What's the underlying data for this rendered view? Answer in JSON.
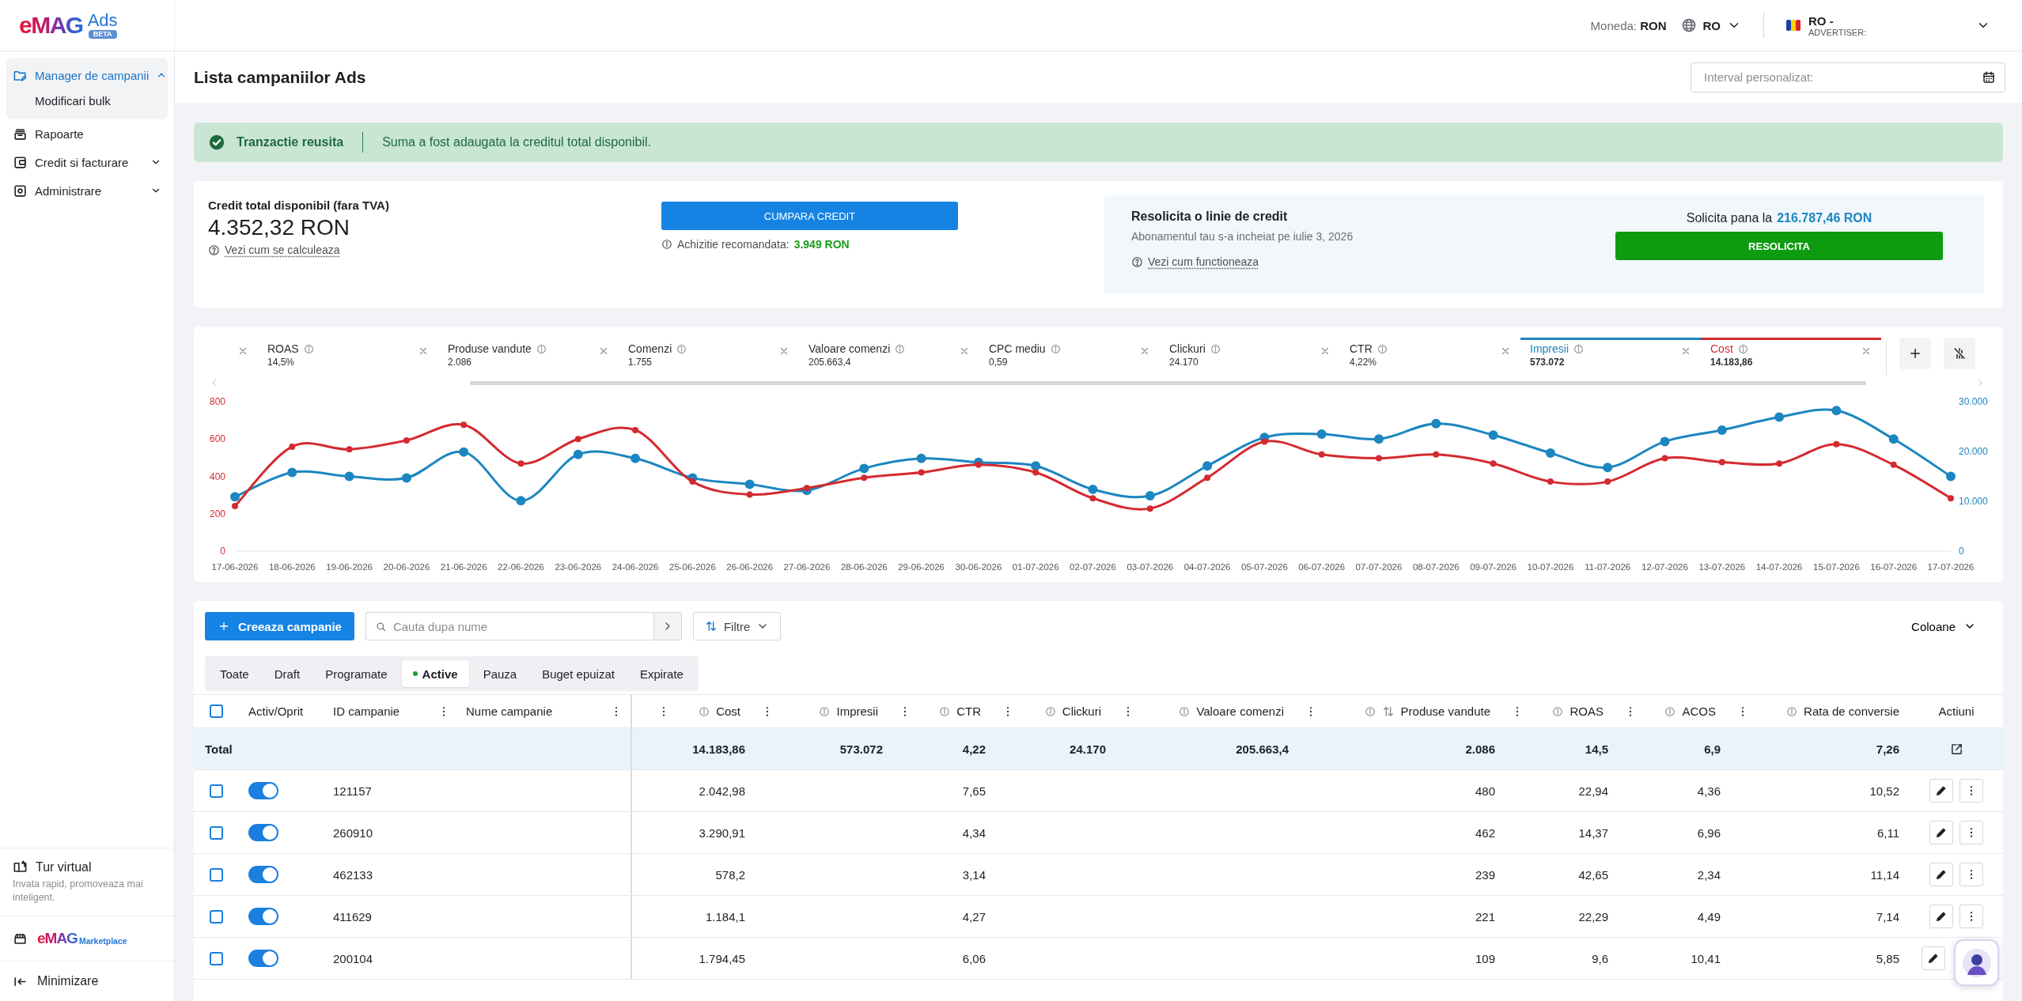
{
  "header": {
    "logo": {
      "brand": "eMAG",
      "product": "Ads",
      "badge": "BETA"
    },
    "currency_label": "Moneda:",
    "currency": "RON",
    "language": "RO",
    "account": {
      "name": "RO -",
      "role": "ADVERTISER:"
    }
  },
  "sidebar": {
    "items": [
      {
        "label": "Manager de campanii",
        "kind": "group",
        "selected": true,
        "expanded": true,
        "children": [
          {
            "label": "Modificari bulk",
            "selected": false
          }
        ]
      },
      {
        "label": "Rapoarte",
        "kind": "link",
        "selected": false,
        "expanded": false
      },
      {
        "label": "Credit si facturare",
        "kind": "group",
        "selected": false,
        "expanded": false
      },
      {
        "label": "Administrare",
        "kind": "group",
        "selected": false,
        "expanded": false
      }
    ],
    "tour": {
      "title": "Tur virtual",
      "text": "Invata rapid, promoveaza mai inteligent."
    },
    "marketplace_logo": {
      "brand": "eMAG",
      "product": "Marketplace"
    },
    "minimize": "Minimizare"
  },
  "page": {
    "title": "Lista campaniilor Ads",
    "date_field": {
      "placeholder": "Interval personalizat:"
    }
  },
  "banner": {
    "title": "Tranzactie reusita",
    "message": "Suma a fost adaugata la creditul total disponibil."
  },
  "credit": {
    "label": "Credit total disponibil (fara TVA)",
    "amount": "4.352,32 RON",
    "help_link": "Vezi cum se calculeaza",
    "buy_button": "CUMPARA CREDIT",
    "recommended_label": "Achizitie recomandata:",
    "recommended_amount": "3.949 RON",
    "credit_line": {
      "title": "Resolicita o linie de credit",
      "text": "Abonamentul tau s-a incheiat pe iulie 3, 2026",
      "help_link": "Vezi cum functioneaza",
      "limit_label": "Solicita pana la",
      "limit_amount": "216.787,46 RON",
      "button": "RESOLICITA"
    }
  },
  "metrics": {
    "items": [
      {
        "kind": "clipped",
        "selected": false
      },
      {
        "kind": "metric",
        "label": "ROAS",
        "value": "14,5%",
        "selected": false
      },
      {
        "kind": "metric",
        "label": "Produse vandute",
        "value": "2.086",
        "selected": false
      },
      {
        "kind": "metric",
        "label": "Comenzi",
        "value": "1.755",
        "selected": false
      },
      {
        "kind": "metric",
        "label": "Valoare comenzi",
        "value": "205.663,4",
        "selected": false
      },
      {
        "kind": "metric",
        "label": "CPC mediu",
        "value": "0,59",
        "selected": false
      },
      {
        "kind": "metric",
        "label": "Clickuri",
        "value": "24.170",
        "selected": false
      },
      {
        "kind": "metric",
        "label": "CTR",
        "value": "4,22%",
        "selected": false
      },
      {
        "kind": "metric",
        "label": "Impresii",
        "value": "573.072",
        "selected": true,
        "color": "#1b86c0"
      },
      {
        "kind": "metric",
        "label": "Cost",
        "value": "14.183,86",
        "selected": true,
        "color": "#d42a2f"
      }
    ]
  },
  "chart": {
    "chart_data": {
      "type": "line",
      "categories": [
        "17-06-2026",
        "18-06-2026",
        "19-06-2026",
        "20-06-2026",
        "21-06-2026",
        "22-06-2026",
        "23-06-2026",
        "24-06-2026",
        "25-06-2026",
        "26-06-2026",
        "27-06-2026",
        "28-06-2026",
        "29-06-2026",
        "30-06-2026",
        "01-07-2026",
        "02-07-2026",
        "03-07-2026",
        "04-07-2026",
        "05-07-2026",
        "06-07-2026",
        "07-07-2026",
        "08-07-2026",
        "09-07-2026",
        "10-07-2026",
        "11-07-2026",
        "12-07-2026",
        "13-07-2026",
        "14-07-2026",
        "15-07-2026",
        "16-07-2026",
        "17-07-2026"
      ],
      "series": [
        {
          "color": "#1b86c0",
          "axis": "y2",
          "marker": "circle",
          "values": [
            10900,
            15800,
            15000,
            14700,
            19900,
            10100,
            19400,
            18600,
            14700,
            13400,
            12200,
            16600,
            18600,
            17800,
            17100,
            12400,
            11100,
            17100,
            22800,
            23500,
            22500,
            25600,
            23300,
            19700,
            16800,
            22000,
            24300,
            26900,
            28200,
            22500,
            15000
          ]
        },
        {
          "color": "#d42a2f",
          "marker": "circle",
          "values": [
            241,
            559,
            545,
            593,
            676,
            469,
            600,
            648,
            372,
            303,
            338,
            393,
            421,
            462,
            421,
            283,
            228,
            393,
            586,
            517,
            497,
            517,
            469,
            372,
            372,
            497,
            476,
            469,
            572,
            462,
            283
          ]
        }
      ],
      "ylim": [
        0,
        800
      ],
      "yticks": [
        0,
        200,
        400,
        600,
        800
      ],
      "y2lim": [
        0,
        30000
      ],
      "y2ticks": [
        {
          "value": 0,
          "label": "0"
        },
        {
          "value": 10000,
          "label": "10.000"
        },
        {
          "value": 20000,
          "label": "20.000"
        },
        {
          "value": 30000,
          "label": "30.000"
        }
      ]
    }
  },
  "campaigns": {
    "create_button": "Creeaza campanie",
    "search": {
      "placeholder": "Cauta dupa nume"
    },
    "filters_button": "Filtre",
    "columns_button": "Coloane",
    "status_tabs": [
      {
        "label": "Toate",
        "selected": false
      },
      {
        "label": "Draft",
        "selected": false
      },
      {
        "label": "Programate",
        "selected": false
      },
      {
        "label": "Active",
        "selected": true,
        "color": "#1a9c3c"
      },
      {
        "label": "Pauza",
        "selected": false
      },
      {
        "label": "Buget epuizat",
        "selected": false
      },
      {
        "label": "Expirate",
        "selected": false
      }
    ],
    "table": {
      "select_all_checked": false,
      "columns": [
        {
          "kind": "check",
          "menu": false,
          "info": false,
          "sortable": false
        },
        {
          "kind": "toggle",
          "label": "Activ/Oprit",
          "menu": false,
          "info": false,
          "sortable": false
        },
        {
          "kind": "text",
          "label": "ID campanie",
          "menu": true,
          "info": false,
          "sortable": false
        },
        {
          "kind": "text",
          "label": "Nume campanie",
          "menu": true,
          "info": false,
          "sortable": false
        },
        {
          "kind": "clipped",
          "menu": true,
          "info": false,
          "sortable": false
        },
        {
          "kind": "number",
          "label": "Cost",
          "menu": true,
          "info": true,
          "sortable": false
        },
        {
          "kind": "number",
          "label": "Impresii",
          "menu": true,
          "info": true,
          "sortable": false
        },
        {
          "kind": "number",
          "label": "CTR",
          "menu": true,
          "info": true,
          "sortable": false
        },
        {
          "kind": "number",
          "label": "Clickuri",
          "menu": true,
          "info": true,
          "sortable": false
        },
        {
          "kind": "number",
          "label": "Valoare comenzi",
          "menu": true,
          "info": true,
          "sortable": false
        },
        {
          "kind": "number",
          "label": "Produse vandute",
          "menu": true,
          "info": true,
          "sortable": true
        },
        {
          "kind": "number",
          "label": "ROAS",
          "menu": true,
          "info": true,
          "sortable": false
        },
        {
          "kind": "number",
          "label": "ACOS",
          "menu": true,
          "info": true,
          "sortable": false
        },
        {
          "kind": "number",
          "label": "Rata de conversie",
          "menu": false,
          "info": true,
          "sortable": false
        },
        {
          "kind": "actions",
          "label": "Actiuni",
          "menu": false,
          "info": false,
          "sortable": false
        }
      ],
      "total": {
        "cells": [
          "Total",
          "",
          "",
          "",
          "",
          "14.183,86",
          "573.072",
          "4,22",
          "24.170",
          "205.663,4",
          "2.086",
          "14,5",
          "6,9",
          "7,26",
          ""
        ]
      },
      "rows": [
        {
          "selected": false,
          "active": true,
          "cells": [
            "",
            "",
            "121157",
            "",
            "",
            "2.042,98",
            "",
            "7,65",
            "",
            "",
            "480",
            "22,94",
            "4,36",
            "10,52",
            ""
          ]
        },
        {
          "selected": false,
          "active": true,
          "cells": [
            "",
            "",
            "260910",
            "",
            "",
            "3.290,91",
            "",
            "4,34",
            "",
            "",
            "462",
            "14,37",
            "6,96",
            "6,11",
            ""
          ]
        },
        {
          "selected": false,
          "active": true,
          "cells": [
            "",
            "",
            "462133",
            "",
            "",
            "578,2",
            "",
            "3,14",
            "",
            "",
            "239",
            "42,65",
            "2,34",
            "11,14",
            ""
          ]
        },
        {
          "selected": false,
          "active": true,
          "cells": [
            "",
            "",
            "411629",
            "",
            "",
            "1.184,1",
            "",
            "4,27",
            "",
            "",
            "221",
            "22,29",
            "4,49",
            "7,14",
            ""
          ]
        },
        {
          "selected": false,
          "active": true,
          "cells": [
            "",
            "",
            "200104",
            "",
            "",
            "1.794,45",
            "",
            "6,06",
            "",
            "",
            "109",
            "9,6",
            "10,41",
            "5,85",
            ""
          ]
        }
      ]
    }
  }
}
